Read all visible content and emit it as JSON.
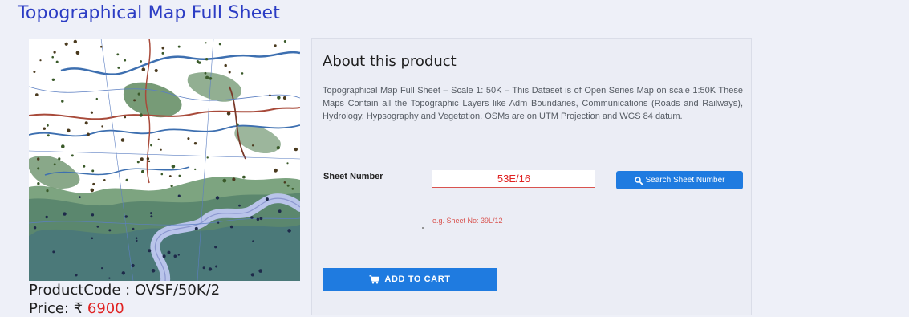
{
  "page": {
    "title": "Topographical Map Full Sheet"
  },
  "product": {
    "image_alt": "topographic-map-preview",
    "code_label": "ProductCode : ",
    "code_value": "OVSF/50K/2",
    "price_label": "Price: ",
    "currency_symbol": "₹",
    "price_value": "6900"
  },
  "about": {
    "heading": "About this product",
    "description": "Topographical Map Full Sheet – Scale 1: 50K – This Dataset is of Open Series Map on scale 1:50K These Maps Contain all the Topographic Layers like Adm Boundaries, Communications (Roads and Railways), Hydrology, Hypsography and Vegetation. OSMs are on UTM Projection and WGS 84 datum."
  },
  "sheet": {
    "label": "Sheet Number",
    "value": "53E/16",
    "search_label": "Search Sheet Number",
    "hint": "e.g. Sheet No: 39L/12"
  },
  "cart": {
    "label": "ADD TO CART"
  },
  "colors": {
    "accent": "#1f7be0",
    "title": "#2b3cc4",
    "price": "#e02222",
    "hint": "#d9534f",
    "background": "#eef0f8"
  },
  "icons": {
    "search": "search-icon",
    "cart": "cart-icon"
  }
}
